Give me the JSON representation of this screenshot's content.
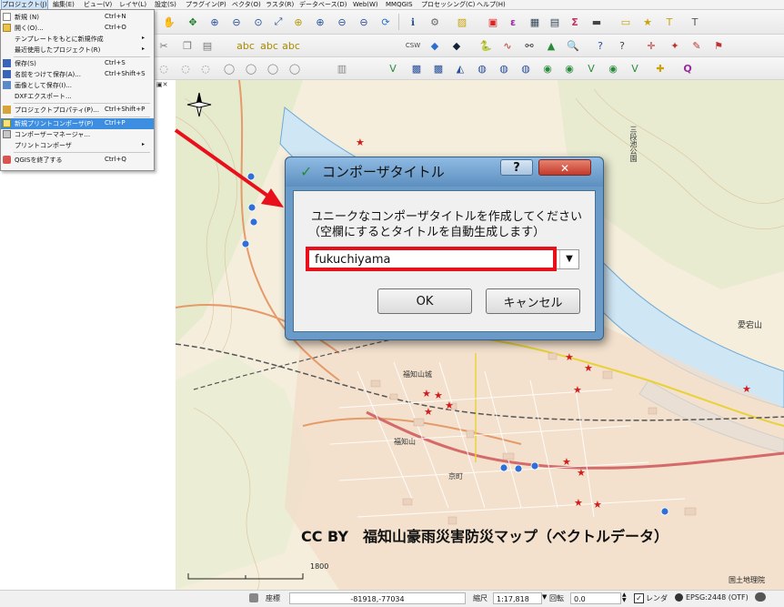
{
  "menubar": {
    "items": [
      {
        "label": "プロジェクト(J)"
      },
      {
        "label": "編集(E)"
      },
      {
        "label": "ビュー(V)"
      },
      {
        "label": "レイヤ(L)"
      },
      {
        "label": "設定(S)"
      },
      {
        "label": "プラグイン(P)"
      },
      {
        "label": "ベクタ(O)"
      },
      {
        "label": "ラスタ(R)"
      },
      {
        "label": "データベース(D)"
      },
      {
        "label": "Web(W)"
      },
      {
        "label": "MMQGIS"
      },
      {
        "label": "プロセッシング(C)"
      },
      {
        "label": "ヘルプ(H)"
      }
    ]
  },
  "file_menu": {
    "items": [
      {
        "label": "新規 (N)",
        "shortcut": "Ctrl+N",
        "icon": "new-project-icon"
      },
      {
        "label": "開く(O)...",
        "shortcut": "Ctrl+O",
        "icon": "open-folder-icon"
      },
      {
        "label": "テンプレートをもとに新規作成",
        "shortcut": "",
        "icon": "",
        "submenu": true
      },
      {
        "label": "最近使用したプロジェクト(R)",
        "shortcut": "",
        "icon": "",
        "submenu": true
      },
      {
        "label": "保存(S)",
        "shortcut": "Ctrl+S",
        "icon": "save-icon"
      },
      {
        "label": "名前をつけて保存(A)...",
        "shortcut": "Ctrl+Shift+S",
        "icon": "save-as-icon"
      },
      {
        "label": "画像として保存(I)...",
        "shortcut": "",
        "icon": "save-image-icon"
      },
      {
        "label": "DXFエクスポート...",
        "shortcut": "",
        "icon": ""
      },
      {
        "label": "プロジェクトプロパティ(P)...",
        "shortcut": "Ctrl+Shift+P",
        "icon": "project-properties-icon"
      },
      {
        "label": "新規プリントコンポーザ(P)",
        "shortcut": "Ctrl+P",
        "icon": "new-composer-icon",
        "highlighted": true
      },
      {
        "label": "コンポーザーマネージャ...",
        "shortcut": "",
        "icon": "composer-manager-icon"
      },
      {
        "label": "プリントコンポーザ",
        "shortcut": "",
        "icon": "",
        "submenu": true
      },
      {
        "label": "QGISを終了する",
        "shortcut": "Ctrl+Q",
        "icon": "exit-icon"
      }
    ]
  },
  "dialog": {
    "title": "コンポーザタイトル",
    "help_button": "?",
    "close_button": "✕",
    "message_line1": "ユニークなコンポーザタイトルを作成してください",
    "message_line2": "（空欄にするとタイトルを自動生成します）",
    "input_value": "fukuchiyama",
    "ok_label": "OK",
    "cancel_label": "キャンセル"
  },
  "map": {
    "caption": "CC BY　福知山豪雨災害防災マップ（ベクトルデータ）",
    "scale_bar_label": "1800",
    "attribution": "国土地理院",
    "place_labels": [
      "福知山",
      "京町",
      "三段池公園",
      "愛宕山",
      "福知山城"
    ]
  },
  "statusbar": {
    "coord_label": "座標",
    "coord_value": "-81918,-77034",
    "scale_label": "縮尺",
    "scale_value": "1:17,818",
    "rotation_label": "回転",
    "rotation_value": "0.0",
    "render_label": "レンダ",
    "crs_label": "EPSG:2448 (OTF)"
  },
  "colors": {
    "annotation_red": "#e8101a",
    "highlight_blue": "#3d8ee0",
    "dialog_frame": "#6a9bc8",
    "close_button_red": "#c9463d"
  }
}
